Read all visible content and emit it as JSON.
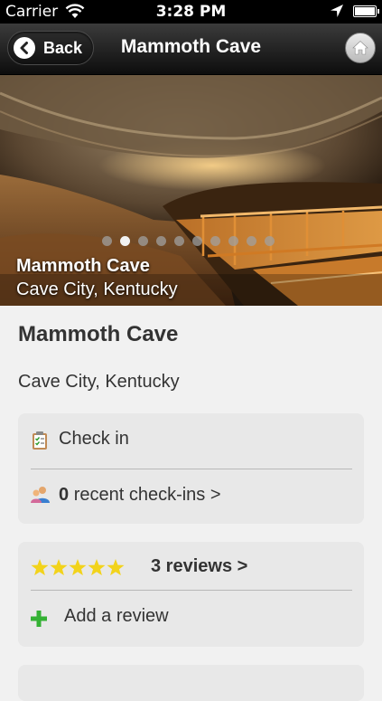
{
  "status_bar": {
    "carrier": "Carrier",
    "time": "3:28 PM"
  },
  "nav": {
    "back_label": "Back",
    "title": "Mammoth Cave"
  },
  "hero": {
    "title": "Mammoth Cave",
    "subtitle": "Cave City, Kentucky",
    "page_count": 10,
    "active_page": 2
  },
  "place": {
    "name": "Mammoth Cave",
    "location": "Cave City, Kentucky"
  },
  "checkin_card": {
    "check_in_label": "Check in",
    "recent_count": "0",
    "recent_label": "recent check-ins >"
  },
  "reviews_card": {
    "rating_stars": 5,
    "reviews_label": "3 reviews >",
    "add_review_label": "Add a review"
  },
  "colors": {
    "star": "#f2d31b",
    "plus": "#34b134",
    "background": "#f1f1f1",
    "card": "#e8e8e8"
  }
}
